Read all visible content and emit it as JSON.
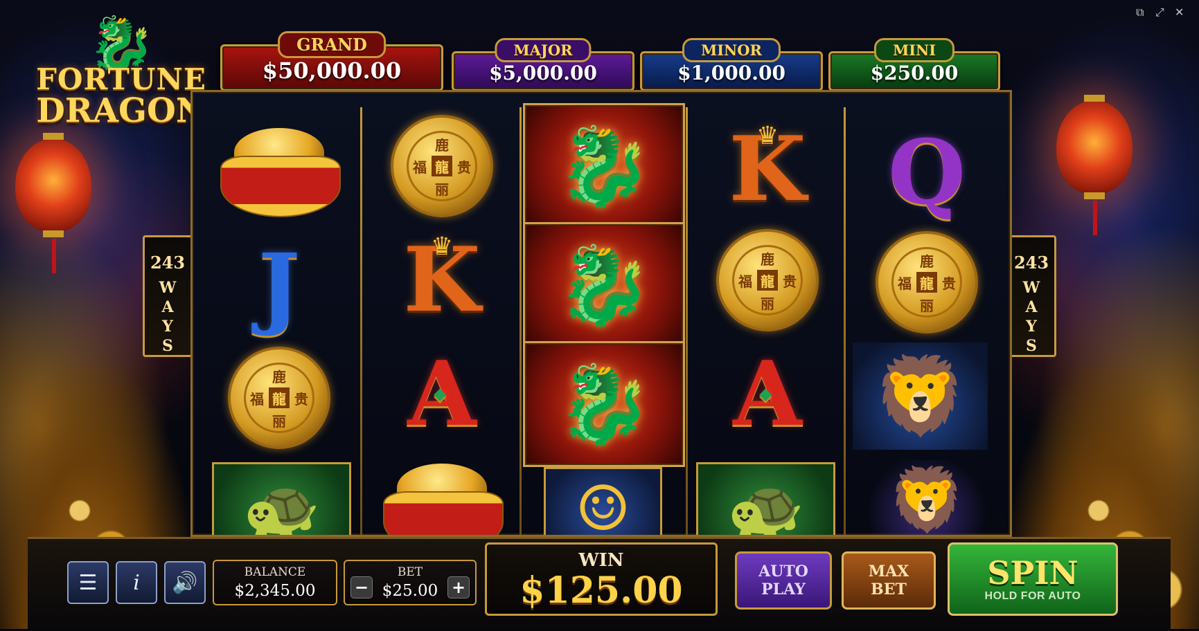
{
  "game": {
    "logo_line1": "FORTUNE",
    "logo_line2": "DRAGON"
  },
  "jackpots": [
    {
      "label": "GRAND",
      "value": "$50,000.00",
      "color": "#8a0f0c"
    },
    {
      "label": "MAJOR",
      "value": "$5,000.00",
      "color": "#4a1478"
    },
    {
      "label": "MINOR",
      "value": "$1,000.00",
      "color": "#102a6a"
    },
    {
      "label": "MINI",
      "value": "$250.00",
      "color": "#0e5418"
    }
  ],
  "ways": {
    "number": "243",
    "word": "WAYS"
  },
  "reels": [
    [
      "gold-ingot",
      "J",
      "coin",
      "turtle"
    ],
    [
      "coin",
      "K",
      "A",
      "gold-ingot"
    ],
    [
      "dragon",
      "dragon",
      "dragon",
      "buddha"
    ],
    [
      "K",
      "coin",
      "A",
      "turtle"
    ],
    [
      "Q",
      "coin",
      "foo-dog",
      "foo-dog"
    ]
  ],
  "controls": {
    "menu_icon": "menu-icon",
    "info_icon": "info-icon",
    "sound_icon": "sound-icon",
    "balance_label": "BALANCE",
    "balance_value": "$2,345.00",
    "bet_label": "BET",
    "bet_value": "$25.00",
    "bet_minus": "−",
    "bet_plus": "+",
    "win_label": "WIN",
    "win_value": "$125.00",
    "auto_play_line1": "AUTO",
    "auto_play_line2": "PLAY",
    "max_bet_line1": "MAX",
    "max_bet_line2": "BET",
    "spin_label": "SPIN",
    "spin_sub": "HOLD FOR AUTO"
  },
  "window_controls": {
    "restore_icon": "⧉",
    "fullscreen_icon": "⤢",
    "close_icon": "✕"
  }
}
